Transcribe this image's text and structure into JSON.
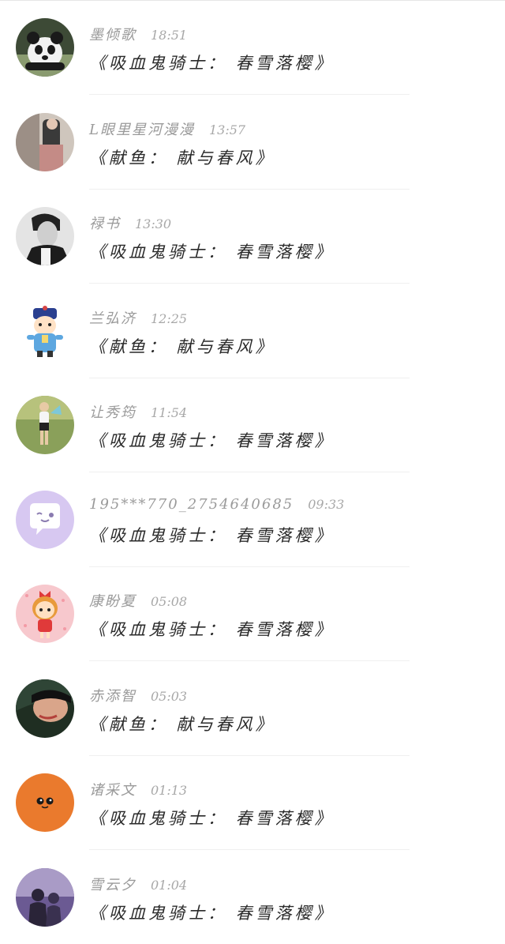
{
  "comments": [
    {
      "user": "墨倾歌",
      "time": "18:51",
      "message": "《吸血鬼骑士： 春雪落樱》",
      "avatar": "panda-avatar",
      "avatar_bg": "#2f3a2a"
    },
    {
      "user": "L眼里星河漫漫",
      "time": "13:57",
      "message": "《献鱼： 献与春风》",
      "avatar": "photo-avatar",
      "avatar_bg": "#6b5a52"
    },
    {
      "user": "禄书",
      "time": "13:30",
      "message": "《吸血鬼骑士： 春雪落樱》",
      "avatar": "man-avatar",
      "avatar_bg": "#d9d9d9"
    },
    {
      "user": "兰弘济",
      "time": "12:25",
      "message": "《献鱼： 献与春风》",
      "avatar": "cartoon-official-avatar",
      "avatar_bg": "#ffffff"
    },
    {
      "user": "让秀筠",
      "time": "11:54",
      "message": "《吸血鬼骑士： 春雪落樱》",
      "avatar": "girl-on-grass-avatar",
      "avatar_bg": "#7a8f4a"
    },
    {
      "user": "195***770_2754640685",
      "time": "09:33",
      "message": "《吸血鬼骑士： 春雪落樱》",
      "avatar": "chat-bubble-avatar",
      "avatar_bg": "#d7c8f1"
    },
    {
      "user": "康盼夏",
      "time": "05:08",
      "message": "《吸血鬼骑士： 春雪落樱》",
      "avatar": "cartoon-girl-avatar",
      "avatar_bg": "#f7c8cd"
    },
    {
      "user": "赤添智",
      "time": "05:03",
      "message": "《献鱼： 献与春风》",
      "avatar": "portrait-avatar",
      "avatar_bg": "#2a3a2c"
    },
    {
      "user": "诸采文",
      "time": "01:13",
      "message": "《吸血鬼骑士： 春雪落樱》",
      "avatar": "orange-face-avatar",
      "avatar_bg": "#ea7a2d"
    },
    {
      "user": "雪云夕",
      "time": "01:04",
      "message": "《吸血鬼骑士： 春雪落樱》",
      "avatar": "couple-avatar",
      "avatar_bg": "#7c6aa0"
    }
  ]
}
